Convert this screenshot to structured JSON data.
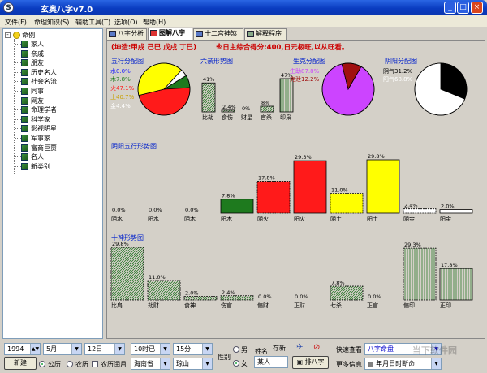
{
  "window": {
    "title": "玄奥八字v7.0",
    "min": "_",
    "max": "□",
    "close": "×"
  },
  "menu": [
    "文件(F)",
    "命理知识(S)",
    "辅助工具(T)",
    "选项(O)",
    "帮助(H)"
  ],
  "tree": {
    "root": "命例",
    "items": [
      "家人",
      "亲戚",
      "朋友",
      "历史名人",
      "社会名流",
      "同事",
      "网友",
      "命理学者",
      "科学家",
      "影视明星",
      "军事家",
      "富商巨贾",
      "名人",
      "新类别"
    ]
  },
  "tabs": [
    "八字分析",
    "图解八字",
    "十二宫神煞",
    "解释程序"
  ],
  "header": {
    "info": "(坤造:甲戌 己巳 戊戌 丁巳)",
    "summary": "※日主综合得分:400,日元极旺,以从旺看。"
  },
  "pie_titles": {
    "wuxing": "五行分配图",
    "shengke": "生克分配图",
    "yinyang": "阴阳分配图",
    "liuqin": "六亲形势图"
  },
  "wuxing_legend": {
    "shui": "水0.0%",
    "mu": "木7.8%",
    "huo": "火47.1%",
    "tu": "土40.7%",
    "jin": "金4.4%"
  },
  "shengke_legend": {
    "a": "生助87.8%",
    "b": "克泄12.2%"
  },
  "yinyang_legend": {
    "a": "阴气31.2%",
    "b": "阳气68.8%"
  },
  "section_titles": {
    "yyw": "阴阳五行形势图",
    "ss": "十神形势图"
  },
  "colors": {
    "shui": "#1a1aff",
    "mu": "#1e7a1e",
    "huo": "#ff1a1a",
    "tu": "#ffff00",
    "jin": "#ffffff",
    "shengzhu": "#cc44ff",
    "kexie": "#a01010",
    "title_blue": "#0020cc",
    "title_red": "#cc0000",
    "hatch": "#2e7a2e"
  },
  "chart_data": [
    {
      "type": "pie",
      "title": "五行分配图",
      "categories": [
        "水",
        "木",
        "火",
        "土",
        "金"
      ],
      "values": [
        0.0,
        7.8,
        47.1,
        40.7,
        4.4
      ]
    },
    {
      "type": "bar",
      "title": "六亲形势图",
      "categories": [
        "比劫",
        "食伤",
        "财星",
        "官杀",
        "印枭"
      ],
      "values": [
        41,
        2.4,
        0.0,
        8,
        47
      ],
      "value_labels": [
        "41%",
        "2.4%",
        "0%",
        "8%",
        "47%"
      ]
    },
    {
      "type": "pie",
      "title": "生克分配图",
      "categories": [
        "生助",
        "克泄"
      ],
      "values": [
        87.8,
        12.2
      ]
    },
    {
      "type": "pie",
      "title": "阴阳分配图",
      "categories": [
        "阴气",
        "阳气"
      ],
      "values": [
        31.2,
        68.8
      ]
    },
    {
      "type": "bar",
      "title": "阴阳五行形势图",
      "categories": [
        "阳水",
        "阴水",
        "阳木",
        "阴木",
        "阳火",
        "阴火",
        "阳土",
        "阴土",
        "阳金",
        "阴金"
      ],
      "values": [
        0.0,
        0.0,
        0.0,
        7.8,
        17.8,
        29.3,
        11.0,
        29.8,
        2.4,
        2.0
      ],
      "value_labels": [
        "0.0%",
        "0.0%",
        "0.0%",
        "7.8%",
        "17.8%",
        "29.3%",
        "11.0%",
        "29.8%",
        "2.4%",
        "2.0%"
      ],
      "display_labels": [
        "阴水",
        "阳水",
        "阴木",
        "阳木",
        "阴火",
        "阳火",
        "阴土",
        "阳土",
        "阴金",
        "阳金"
      ]
    },
    {
      "type": "bar",
      "title": "十神形势图",
      "categories": [
        "比肩",
        "劫财",
        "食神",
        "伤官",
        "偏财",
        "正财",
        "七杀",
        "正官",
        "偏印",
        "正印"
      ],
      "values": [
        29.8,
        11.0,
        2.0,
        2.4,
        0.0,
        0.0,
        7.8,
        0.0,
        29.3,
        17.8
      ],
      "value_labels": [
        "29.8%",
        "11.0%",
        "2.0%",
        "2.4%",
        "0.0%",
        "0.0%",
        "7.8%",
        "0.0%",
        "29.3%",
        "17.8%"
      ]
    }
  ],
  "form": {
    "year": "1994",
    "month": "5月",
    "day": "12日",
    "hour": "10时已",
    "minute": "15分",
    "calendar_label1": "公历",
    "calendar_label2": "农历",
    "leap_label": "农历闰月",
    "province": "海南省",
    "city": "琼山",
    "gender_label": "性别",
    "male": "男",
    "female": "女",
    "name_label": "姓名",
    "name_value": "某人",
    "save_label": "存新",
    "new_btn": "新建",
    "paipan_btn": "排八字",
    "quick_label": "快速查看",
    "quick_value": "八字命盘",
    "more_label": "更多信息",
    "more_value": "年月日时断命"
  },
  "watermark": "当下软件园"
}
